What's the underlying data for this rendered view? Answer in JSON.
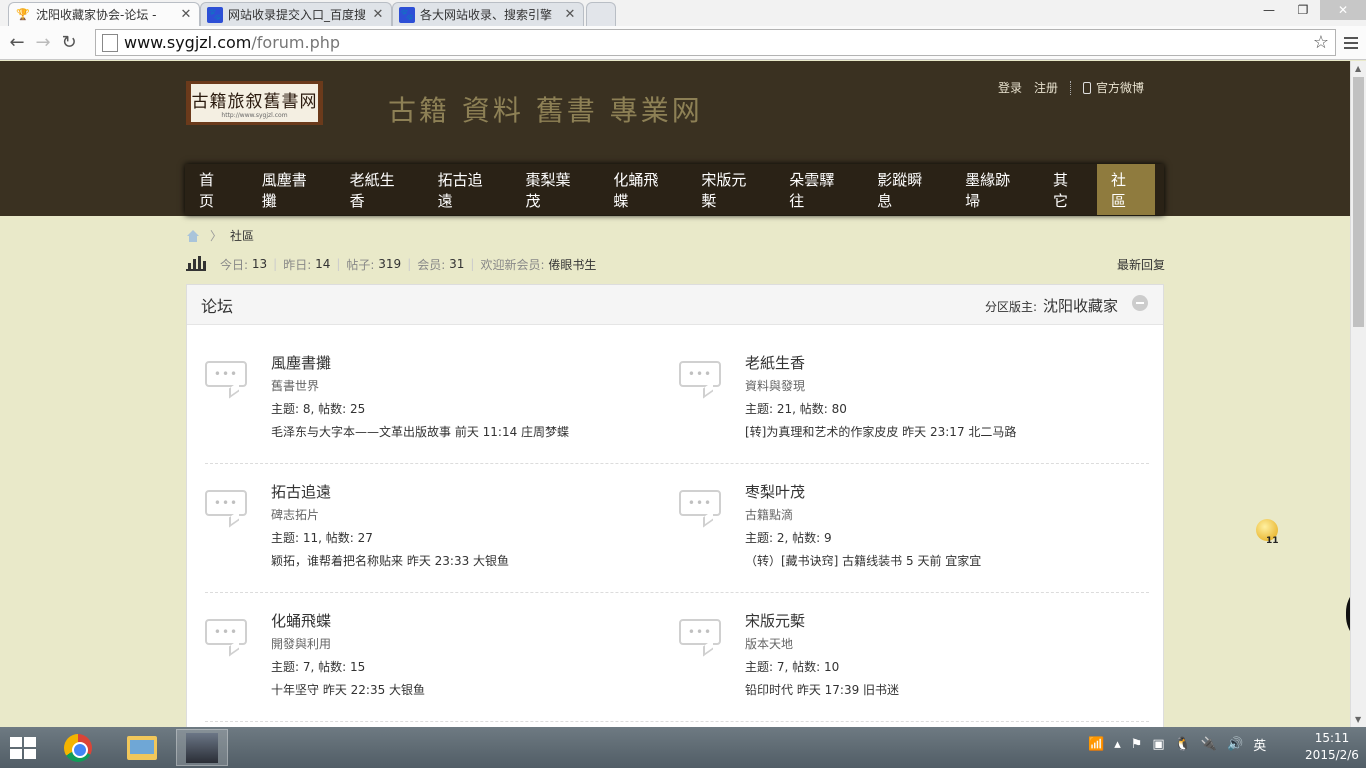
{
  "browser": {
    "tabs": [
      {
        "title": "沈阳收藏家协会-论坛 -",
        "active": true
      },
      {
        "title": "网站收录提交入口_百度搜",
        "active": false
      },
      {
        "title": "各大网站收录、搜索引擎",
        "active": false
      }
    ],
    "url_host": "www.sygjzl.com",
    "url_path": "/forum.php"
  },
  "site": {
    "logo_text": "古籍旅叙舊書网",
    "logo_url": "http://www.sygjzl.com",
    "slogan": "古籍 資料 舊書 專業网",
    "top_links": {
      "login": "登录",
      "register": "注册",
      "weibo": "官方微博"
    },
    "nav": [
      "首 页",
      "風塵書攤",
      "老紙生香",
      "拓古追遠",
      "棗梨葉茂",
      "化蛹飛蝶",
      "宋版元槧",
      "朵雲驛往",
      "影蹤瞬息",
      "墨緣跡埽",
      "其它",
      "社區"
    ]
  },
  "breadcrumb": {
    "current": "社區"
  },
  "stats": {
    "today_label": "今日:",
    "today": "13",
    "yesterday_label": "昨日:",
    "yesterday": "14",
    "posts_label": "帖子:",
    "posts": "319",
    "members_label": "会员:",
    "members": "31",
    "welcome_label": "欢迎新会员:",
    "newest_member": "倦眼书生",
    "latest_reply": "最新回复"
  },
  "forum": {
    "title": "论坛",
    "moderator_label": "分区版主:",
    "moderator": "沈阳收藏家",
    "boards": [
      {
        "name": "風塵書攤",
        "desc": "舊書世界",
        "counts": "主题: 8, 帖数: 25",
        "last": "毛泽东与大字本——文革出版故事 前天 11:14 庄周梦蝶"
      },
      {
        "name": "老紙生香",
        "desc": "資料與發現",
        "counts": "主题: 21, 帖数: 80",
        "last": "[转]为真理和艺术的作家皮皮 昨天 23:17 北二马路"
      },
      {
        "name": "拓古追遠",
        "desc": "碑志拓片",
        "counts": "主题: 11, 帖数: 27",
        "last": "颖拓，谁帮着把名称贴来 昨天 23:33 大银鱼"
      },
      {
        "name": "枣梨叶茂",
        "desc": "古籍點滴",
        "counts": "主题: 2, 帖数: 9",
        "last": "（转）[藏书诀窍] 古籍线装书 5 天前 宜家宜"
      },
      {
        "name": "化蛹飛蝶",
        "desc": "開發與利用",
        "counts": "主题: 7, 帖数: 15",
        "last": "十年坚守 昨天 22:35 大银鱼"
      },
      {
        "name": "宋版元槧",
        "desc": "版本天地",
        "counts": "主题: 7, 帖数: 10",
        "last": "铅印时代 昨天 17:39 旧书迷"
      }
    ]
  },
  "float_badge": "11",
  "taskbar": {
    "ime": "英",
    "time": "15:11",
    "date": "2015/2/6"
  }
}
